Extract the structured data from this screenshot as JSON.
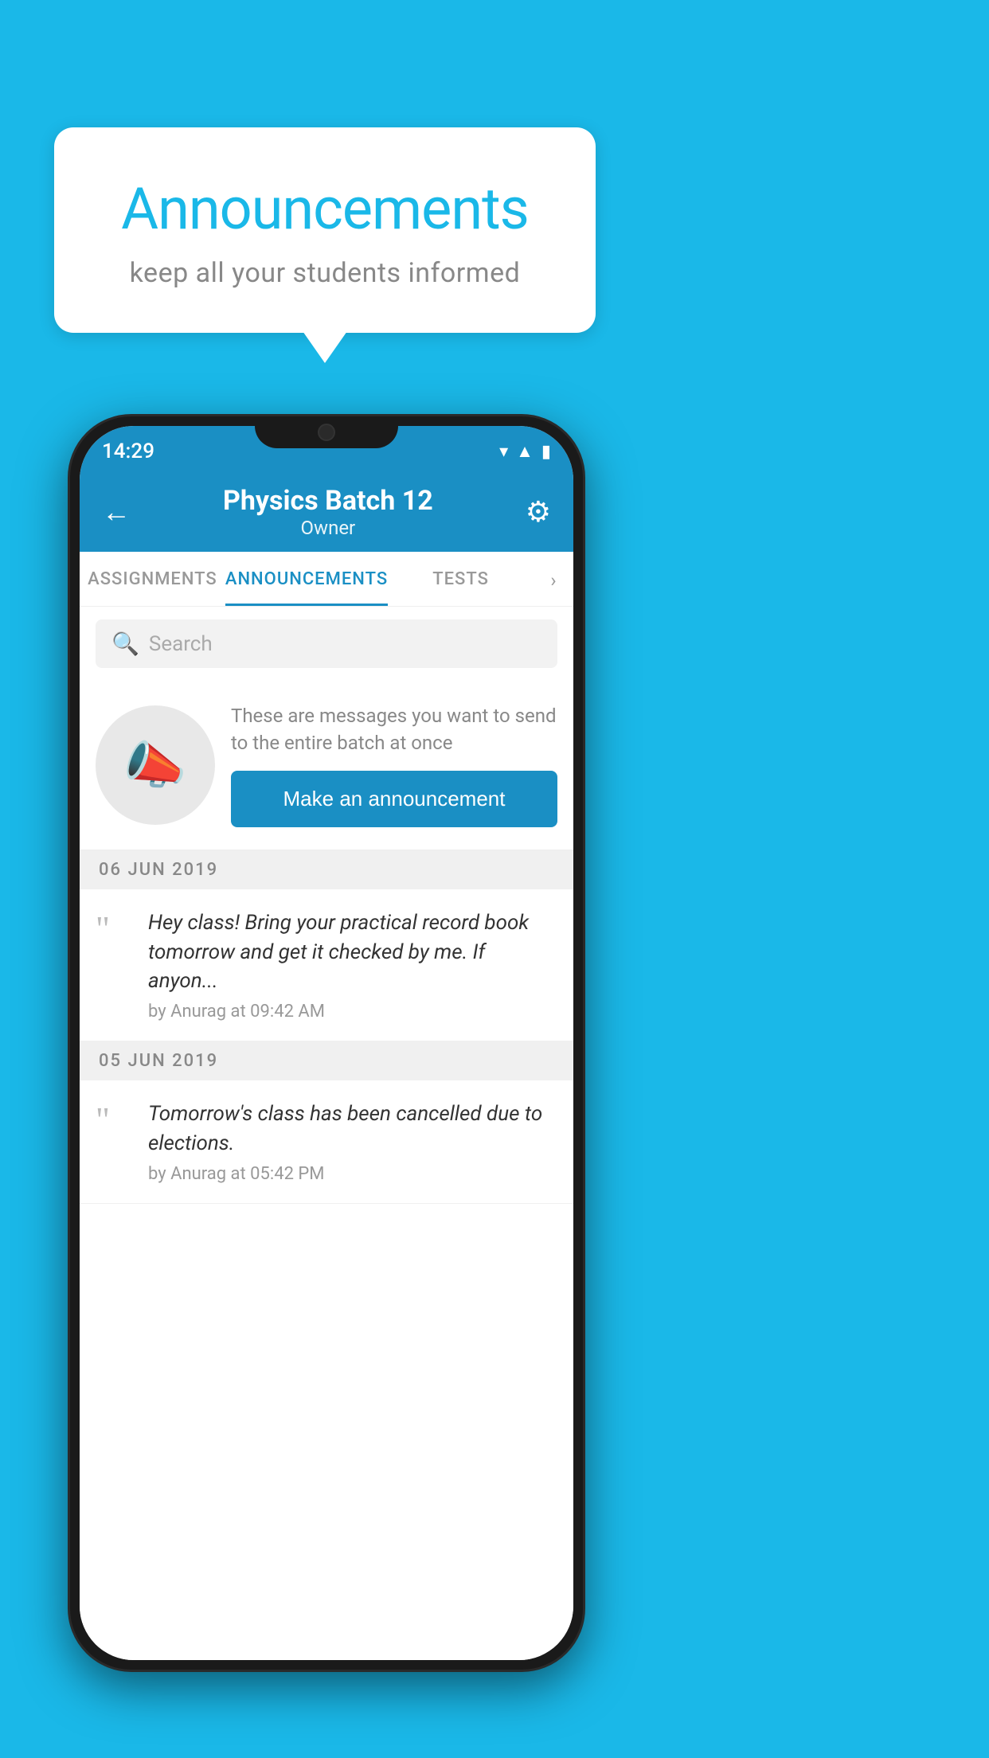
{
  "background": {
    "color": "#1ab8e8"
  },
  "speech_bubble": {
    "title": "Announcements",
    "subtitle": "keep all your students informed"
  },
  "phone": {
    "status_bar": {
      "time": "14:29",
      "icons": [
        "wifi",
        "signal",
        "battery"
      ]
    },
    "app_bar": {
      "back_label": "←",
      "title": "Physics Batch 12",
      "subtitle": "Owner",
      "settings_label": "⚙"
    },
    "tabs": [
      {
        "label": "ASSIGNMENTS",
        "active": false
      },
      {
        "label": "ANNOUNCEMENTS",
        "active": true
      },
      {
        "label": "TESTS",
        "active": false
      }
    ],
    "search": {
      "placeholder": "Search"
    },
    "promo": {
      "description_text": "These are messages you want to send to the entire batch at once",
      "cta_label": "Make an announcement"
    },
    "announcements": [
      {
        "date": "06  JUN  2019",
        "text": "Hey class! Bring your practical record book tomorrow and get it checked by me. If anyon...",
        "meta": "by Anurag at 09:42 AM"
      },
      {
        "date": "05  JUN  2019",
        "text": "Tomorrow's class has been cancelled due to elections.",
        "meta": "by Anurag at 05:42 PM"
      }
    ]
  }
}
